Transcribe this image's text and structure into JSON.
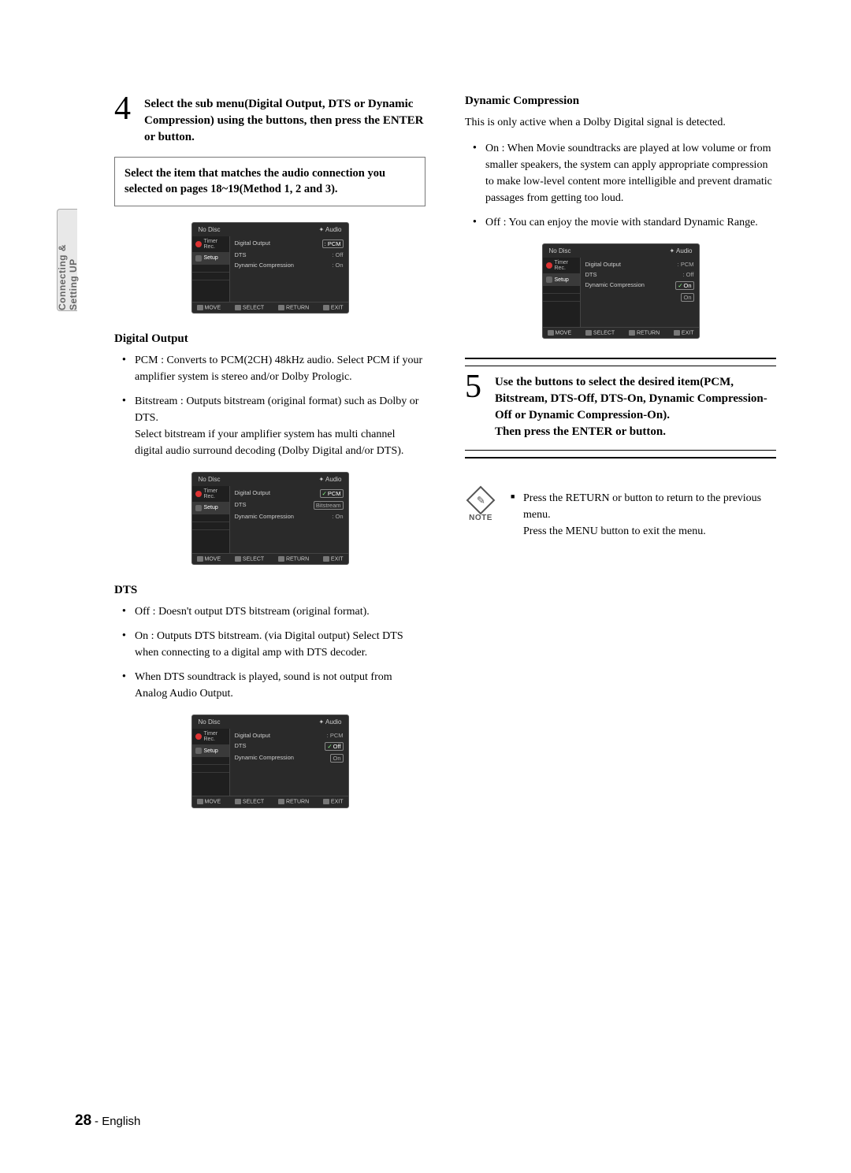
{
  "sidebar_tab": "Connecting & Setting UP",
  "step4": {
    "num": "4",
    "text": "Select the sub menu(Digital Output, DTS or Dynamic Compression) using the buttons, then press the ENTER or       button."
  },
  "match_note": "Select the item that matches the audio connection you selected on pages 18~19(Method 1, 2 and 3).",
  "osd_common": {
    "no_disc": "No Disc",
    "audio_crumb": "Audio",
    "side_timer": "Timer Rec.",
    "side_setup": "Setup",
    "digital_output": "Digital Output",
    "dts": "DTS",
    "dyn_comp": "Dynamic Compression",
    "move": "MOVE",
    "select": "SELECT",
    "return": "RETURN",
    "exit": "EXIT"
  },
  "osd1": {
    "digital_output_val": ": PCM",
    "dts_val": ": Off",
    "dyn_val": ": On"
  },
  "osd2": {
    "digital_output_val": "PCM",
    "digital_output_opt2": "Bitstream",
    "dts_val": "",
    "dyn_val": ": On"
  },
  "osd3": {
    "digital_output_val": ": PCM",
    "dts_val": "Off",
    "dts_opt2": "On",
    "dyn_val": ""
  },
  "osd4": {
    "digital_output_val": ": PCM",
    "dts_val": ": Off",
    "dyn_val": "On",
    "dyn_opt2": "On"
  },
  "digital_output": {
    "heading": "Digital Output",
    "b1": "PCM : Converts to PCM(2CH) 48kHz audio. Select PCM if your amplifier system is stereo and/or Dolby Prologic.",
    "b2": "Bitstream : Outputs bitstream (original format) such as Dolby or DTS.",
    "b2b": "Select bitstream if your amplifier system has multi channel digital audio surround decoding (Dolby Digital and/or DTS)."
  },
  "dts": {
    "heading": "DTS",
    "b1": "Off : Doesn't output DTS bitstream (original format).",
    "b2": "On : Outputs DTS bitstream. (via Digital output) Select DTS when connecting to a digital amp with DTS decoder.",
    "b3": "When DTS soundtrack is played, sound is not output from Analog Audio Output."
  },
  "dyn": {
    "heading": "Dynamic Compression",
    "intro": "This is only active when a Dolby Digital signal is detected.",
    "b1": "On : When Movie soundtracks are played at low volume or from smaller speakers, the system can apply appropriate compression to make low-level content more intelligible and prevent dramatic passages from getting too loud.",
    "b2": "Off : You can enjoy the movie with standard Dynamic Range."
  },
  "step5": {
    "num": "5",
    "text": "Use the           buttons to select the desired item(PCM, Bitstream, DTS-Off, DTS-On, Dynamic Compression-Off or Dynamic Compression-On).",
    "text2": "Then press the ENTER or       button."
  },
  "note": {
    "label": "NOTE",
    "l1": "Press the RETURN or        button to return to the previous menu.",
    "l2": "Press the MENU button to exit the menu."
  },
  "footer": {
    "page": "28",
    "sep": "- ",
    "lang": "English"
  }
}
